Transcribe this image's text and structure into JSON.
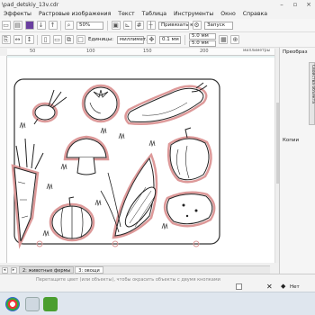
{
  "window": {
    "title": "\\pad_detskiy_13v.cdr"
  },
  "menu": {
    "items": [
      "Эффекты",
      "Растровые изображения",
      "Текст",
      "Таблица",
      "Инструменты",
      "Окно",
      "Справка"
    ]
  },
  "toolbar1": {
    "zoom": "50%",
    "snap_label": "Привязать к",
    "launch_label": "Запуск"
  },
  "toolbar2": {
    "units_label": "Единицы:",
    "units_value": "миллимет...",
    "nudge_value": "0.1 мм",
    "dup_x": "5.0 мм",
    "dup_y": "5.0 мм"
  },
  "ruler": {
    "ticks": [
      "50",
      "100",
      "150",
      "200"
    ],
    "units_label": "миллиметры"
  },
  "docker": {
    "title": "Преобраз",
    "tab_label": "Свойства объекта",
    "copies_label": "Копии"
  },
  "pagetabs": [
    "2: животные фермы",
    "3: овощи"
  ],
  "status": {
    "hint": "Перетащите цвет (или объекты), чтобы окрасить объекты с двумя кнопками",
    "fill": "Нет"
  }
}
